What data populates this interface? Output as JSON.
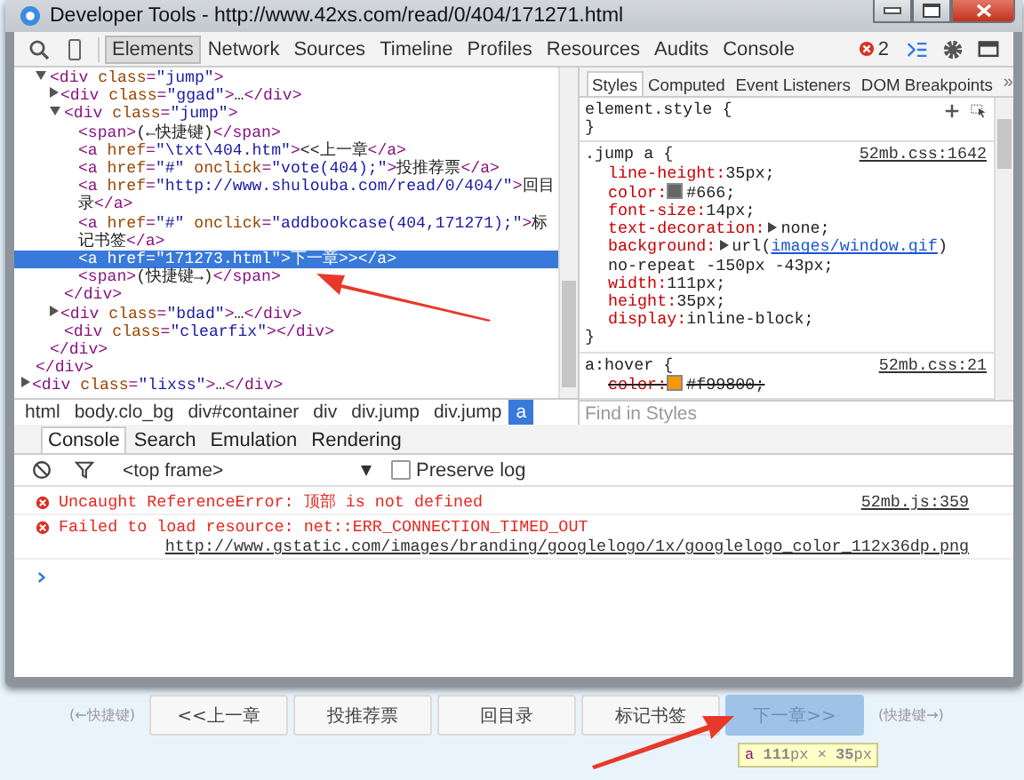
{
  "window": {
    "title": "Developer Tools - http://www.42xs.com/read/0/404/171271.html"
  },
  "toolbar": {
    "tabs": [
      {
        "label": "Elements",
        "selected": true
      },
      {
        "label": "Network",
        "selected": false
      },
      {
        "label": "Sources",
        "selected": false
      },
      {
        "label": "Timeline",
        "selected": false
      },
      {
        "label": "Profiles",
        "selected": false
      },
      {
        "label": "Resources",
        "selected": false
      },
      {
        "label": "Audits",
        "selected": false
      },
      {
        "label": "Console",
        "selected": false
      }
    ],
    "error_count": "2"
  },
  "dom_tree": [
    {
      "closing": "</div>",
      "children": [
        {
          "markup": "<div class=\"jump\">",
          "expanded": true,
          "selected": false,
          "closing": "</div>",
          "children": [
            {
              "markup": "<div class=\"ggad\">…</div>",
              "expanded": false,
              "selected": false
            },
            {
              "markup": "<div class=\"jump\">",
              "expanded": true,
              "selected": false,
              "closing": "</div>",
              "children": [
                {
                  "markup": "<span>(←快捷键)</span>",
                  "selected": false
                },
                {
                  "markup": "<a href=\"\\txt\\404.htm\"><<上一章</a>",
                  "selected": false
                },
                {
                  "markup": "<a href=\"#\" onclick=\"vote(404);\">投推荐票</a>",
                  "selected": false
                },
                {
                  "markup": "<a href=\"http://www.shulouba.com/read/0/404/\">回目录</a>",
                  "selected": false
                },
                {
                  "markup": "<a href=\"#\" onclick=\"addbookcase(404,171271);\">标记书签</a>",
                  "selected": false
                },
                {
                  "markup": "<a href=\"171273.html\">下一章>></a>",
                  "selected": true
                },
                {
                  "markup": "<span>(快捷键→)</span>",
                  "selected": false
                }
              ]
            },
            {
              "markup": "<div class=\"bdad\">…</div>",
              "expanded": false,
              "selected": false
            },
            {
              "markup": "<div class=\"clearfix\"></div>",
              "selected": false
            }
          ]
        }
      ]
    },
    {
      "markup": "<div class=\"lixss\">…</div>",
      "expanded": false,
      "selected": false
    }
  ],
  "breadcrumbs": [
    {
      "label": "html",
      "selected": false
    },
    {
      "label": "body.clo_bg",
      "selected": false
    },
    {
      "label": "div#container",
      "selected": false
    },
    {
      "label": "div",
      "selected": false
    },
    {
      "label": "div.jump",
      "selected": false
    },
    {
      "label": "div.jump",
      "selected": false
    },
    {
      "label": "a",
      "selected": true
    }
  ],
  "styles": {
    "tabs": [
      {
        "label": "Styles",
        "selected": true
      },
      {
        "label": "Computed",
        "selected": false
      },
      {
        "label": "Event Listeners",
        "selected": false
      },
      {
        "label": "DOM Breakpoints",
        "selected": false
      }
    ],
    "more": "»",
    "rules": [
      {
        "kind": "inline",
        "selector": "element.style {",
        "closing": "}"
      },
      {
        "kind": "matched",
        "selector": ".jump a {",
        "source": "52mb.css:1642",
        "closing": "}",
        "properties": [
          {
            "name": "line-height:",
            "value": "35px;"
          },
          {
            "name": "color:",
            "color": "#666666",
            "value": "#666;"
          },
          {
            "name": "font-size:",
            "value": "14px;"
          },
          {
            "name": "text-decoration:",
            "expandable": true,
            "value": "none;"
          },
          {
            "name": "background:",
            "expandable": true,
            "value": "url(",
            "link": "images/window.gif",
            "value_after": ") no-repeat -150px -43px;"
          },
          {
            "name": "width:",
            "value": "111px;"
          },
          {
            "name": "height:",
            "value": "35px;"
          },
          {
            "name": "display:",
            "value": "inline-block;"
          }
        ]
      },
      {
        "kind": "matched",
        "selector": "a:hover {",
        "source": "52mb.css:21",
        "properties": [
          {
            "name": "color:",
            "color": "#f99800",
            "value": "#f99800;",
            "overridden": true
          }
        ]
      }
    ],
    "find": {
      "placeholder": "Find in Styles"
    }
  },
  "drawer": {
    "tabs": [
      {
        "label": "Console",
        "selected": true
      },
      {
        "label": "Search",
        "selected": false
      },
      {
        "label": "Emulation",
        "selected": false
      },
      {
        "label": "Rendering",
        "selected": false
      }
    ],
    "frame": "<top frame>",
    "preserve_log": {
      "label": "Preserve log",
      "checked": false
    },
    "messages": [
      {
        "kind": "error",
        "text": "Uncaught ReferenceError: 顶部 is not defined",
        "source": "52mb.js:359"
      },
      {
        "kind": "error",
        "text": "Failed to load resource: net::ERR_CONNECTION_TIMED_OUT",
        "url": "http://www.gstatic.com/images/branding/googlelogo/1x/googlelogo_color_112x36dp.png"
      }
    ]
  },
  "page_nav": [
    {
      "kind": "hint",
      "label": "(←快捷键)"
    },
    {
      "kind": "button",
      "label": "<<上一章",
      "highlighted": false
    },
    {
      "kind": "button",
      "label": "投推荐票",
      "highlighted": false
    },
    {
      "kind": "button",
      "label": "回目录",
      "highlighted": false
    },
    {
      "kind": "button",
      "label": "标记书签",
      "highlighted": false
    },
    {
      "kind": "button",
      "label": "下一章>>",
      "highlighted": true
    },
    {
      "kind": "hint",
      "label": "(快捷键→)"
    }
  ],
  "tooltip": {
    "tag": "a",
    "size": "**111**px × **35**px"
  }
}
